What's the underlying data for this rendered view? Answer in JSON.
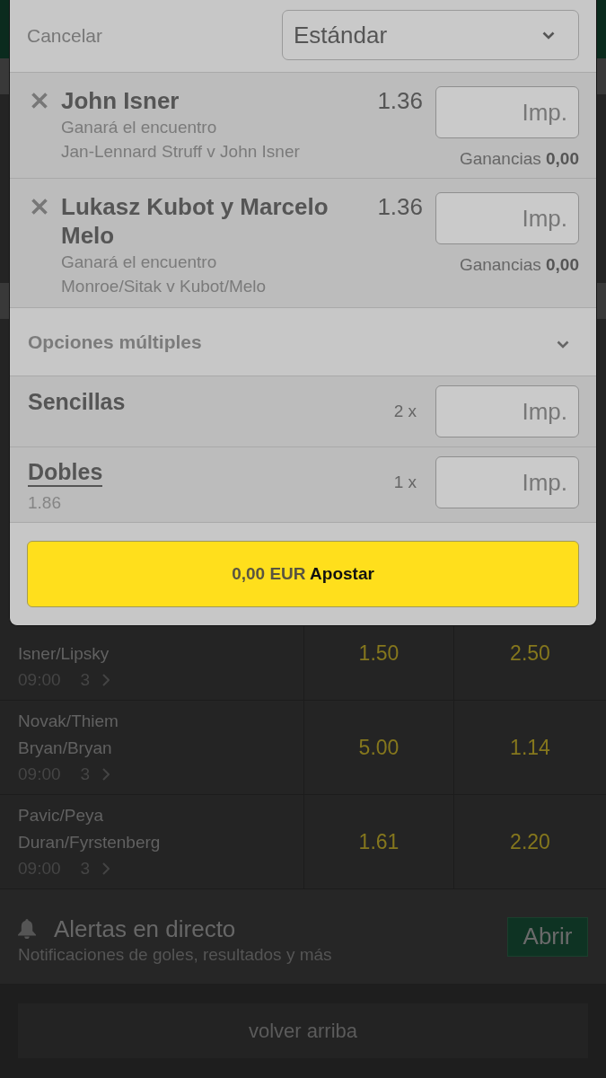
{
  "bet_slip": {
    "cancel": "Cancelar",
    "bet_type": {
      "value": "Estándar"
    },
    "selections": [
      {
        "name": "John Isner",
        "market": "Ganará el encuentro",
        "event": "Jan-Lennard Struff v John Isner",
        "odds": "1.36",
        "stake": {
          "placeholder": "Imp."
        },
        "winnings": "Ganancias **0,00**"
      },
      {
        "name": "Lukasz Kubot y Marcelo Melo",
        "market": "Ganará el encuentro",
        "event": "Monroe/Sitak v Kubot/Melo",
        "odds": "1.36",
        "stake": {
          "placeholder": "Imp."
        },
        "winnings": "Ganancias **0,00**"
      }
    ],
    "multiple_options": {
      "label": "Opciones múltiples"
    },
    "multiples": [
      {
        "kind": "label",
        "name": "Sencillas",
        "count": "2 x",
        "stake": {
          "placeholder": "Imp."
        }
      },
      {
        "kind": "link",
        "name": "Dobles",
        "odds": "1.86",
        "count": "1 x",
        "stake": {
          "placeholder": "Imp."
        }
      }
    ],
    "place_bet": {
      "amount": "0,00 EUR",
      "label": "Apostar"
    }
  },
  "matches": [
    {
      "teams": [
        "Isner/Lipsky"
      ],
      "time": "09:00",
      "markets": "3",
      "odds": [
        "1.50",
        "2.50"
      ]
    },
    {
      "teams": [
        "Novak/Thiem",
        "Bryan/Bryan"
      ],
      "time": "09:00",
      "markets": "3",
      "odds": [
        "5.00",
        "1.14"
      ]
    },
    {
      "teams": [
        "Pavic/Peya",
        "Duran/Fyrstenberg"
      ],
      "time": "09:00",
      "markets": "3",
      "odds": [
        "1.61",
        "2.20"
      ]
    }
  ],
  "alerts": {
    "title": "Alertas en directo",
    "subtitle": "Notificaciones de goles, resultados y más",
    "button": "Abrir"
  },
  "back_to_top": "volver arriba"
}
